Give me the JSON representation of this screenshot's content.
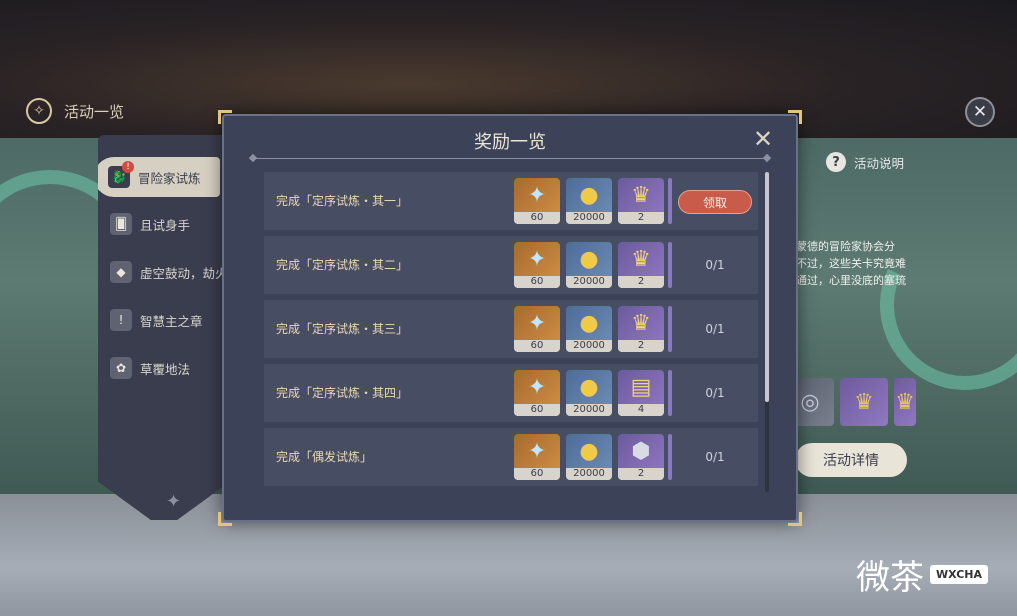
{
  "header": {
    "title": "活动一览",
    "close_icon": "✕"
  },
  "sidebar": {
    "items": [
      {
        "label": "冒险家试炼",
        "icon": "🐉",
        "active": true,
        "badge": "!"
      },
      {
        "label": "且试身手",
        "icon": "🂠"
      },
      {
        "label": "虚空鼓动，劫火",
        "icon": "◆"
      },
      {
        "label": "智慧主之章",
        "icon": "!"
      },
      {
        "label": "草覆地法",
        "icon": "✿"
      }
    ]
  },
  "event": {
    "help_label": "活动说明",
    "description": [
      "蒙德的冒险家协会分",
      "不过，这些关卡究竟难",
      "通过，心里没底的塞琉"
    ],
    "details_button": "活动详情"
  },
  "modal": {
    "title": "奖励一览",
    "rows": [
      {
        "label": "完成「定序试炼・其一」",
        "rewards": [
          "60",
          "20000",
          "2"
        ],
        "status": "领取",
        "claimable": true
      },
      {
        "label": "完成「定序试炼・其二」",
        "rewards": [
          "60",
          "20000",
          "2"
        ],
        "status": "0/1",
        "claimable": false
      },
      {
        "label": "完成「定序试炼・其三」",
        "rewards": [
          "60",
          "20000",
          "2"
        ],
        "status": "0/1",
        "claimable": false
      },
      {
        "label": "完成「定序试炼・其四」",
        "rewards": [
          "60",
          "20000",
          "4"
        ],
        "status": "0/1",
        "claimable": false
      },
      {
        "label": "完成「偶发试炼」",
        "rewards": [
          "60",
          "20000",
          "2"
        ],
        "status": "0/1",
        "claimable": false
      }
    ]
  },
  "watermark": {
    "text": "微茶",
    "tag": "WXCHA"
  },
  "colors": {
    "claim_button": "#c95b4b",
    "modal_bg": "#3c4257",
    "corner_gold": "#e3c57a"
  }
}
